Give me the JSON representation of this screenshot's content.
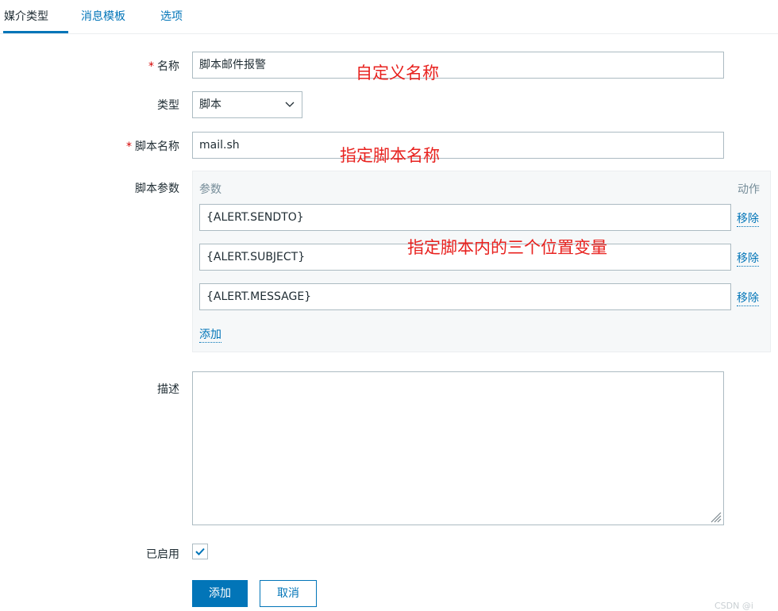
{
  "tabs": [
    {
      "label": "媒介类型",
      "active": true
    },
    {
      "label": "消息模板",
      "active": false
    },
    {
      "label": "选项",
      "active": false
    }
  ],
  "form": {
    "name": {
      "label": "名称",
      "required_mark": "*",
      "value": "脚本邮件报警"
    },
    "type": {
      "label": "类型",
      "value": "脚本"
    },
    "script_name": {
      "label": "脚本名称",
      "required_mark": "*",
      "value": "mail.sh"
    },
    "script_params": {
      "label": "脚本参数",
      "col_param": "参数",
      "col_action": "动作",
      "items": [
        {
          "value": "{ALERT.SENDTO}",
          "remove": "移除"
        },
        {
          "value": "{ALERT.SUBJECT}",
          "remove": "移除"
        },
        {
          "value": "{ALERT.MESSAGE}",
          "remove": "移除"
        }
      ],
      "add_link": "添加"
    },
    "description": {
      "label": "描述",
      "value": ""
    },
    "enabled": {
      "label": "已启用",
      "checked": true
    }
  },
  "buttons": {
    "add": "添加",
    "cancel": "取消"
  },
  "annotations": {
    "name_note": "自定义名称",
    "script_note": "指定脚本名称",
    "params_note": "指定脚本内的三个位置变量"
  },
  "watermark": "CSDN @i",
  "colors": {
    "accent": "#0275b8",
    "annotation": "#e8221f",
    "required": "#d40000"
  }
}
